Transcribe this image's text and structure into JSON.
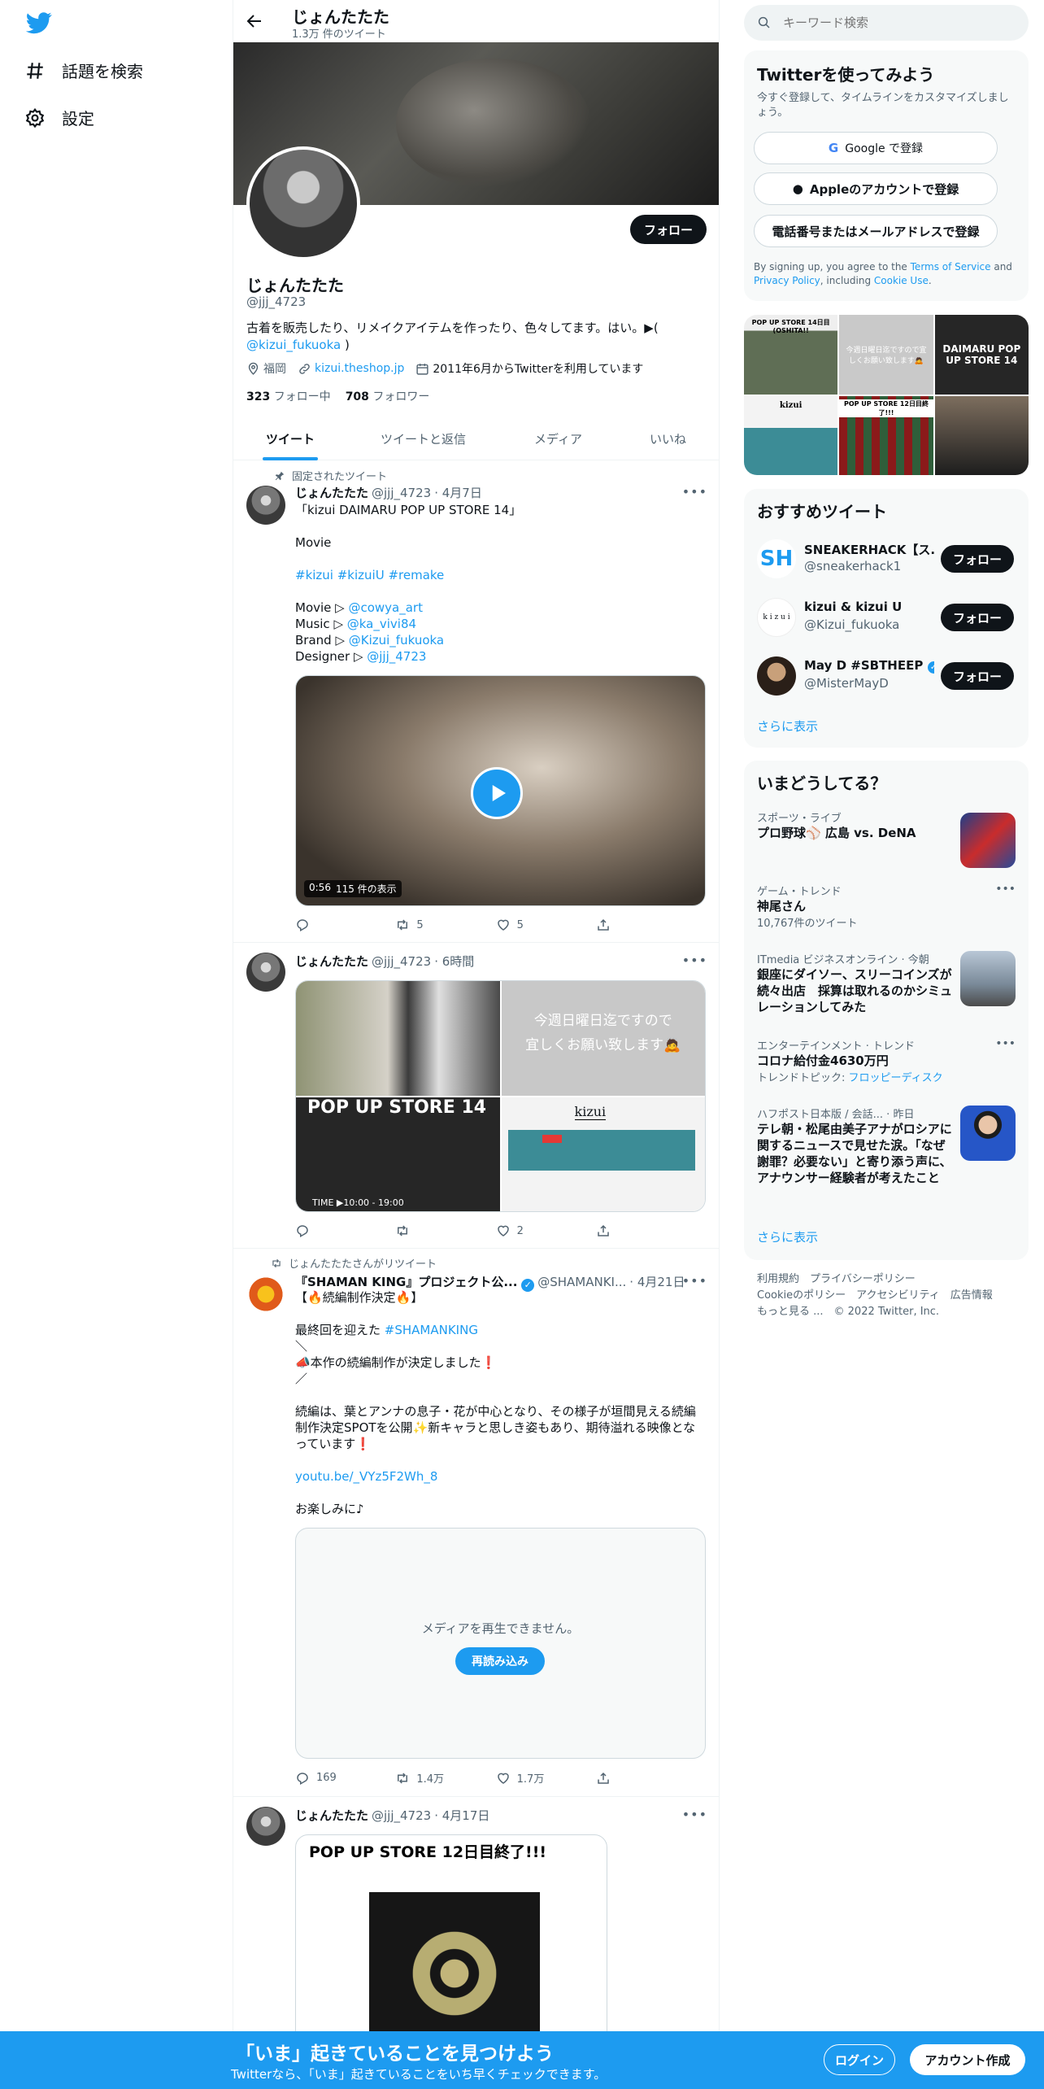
{
  "nav": {
    "explore": "話題を検索",
    "settings": "設定"
  },
  "header": {
    "title": "じょんたたた",
    "tweet_count": "1.3万 件のツイート"
  },
  "profile": {
    "name": "じょんたたた",
    "handle": "@jjj_4723",
    "bio_text": "古着を販売したり、リメイクアイテムを作ったり、色々してます。はい。▶(",
    "bio_link": "@kizui_fukuoka",
    "bio_end": ")",
    "location": "福岡",
    "website": "kizui.theshop.jp",
    "joined": "2011年6月からTwitterを利用しています",
    "following_count": "323",
    "following_label": "フォロー中",
    "followers_count": "708",
    "followers_label": "フォロワー",
    "follow_button": "フォロー"
  },
  "tabs": [
    "ツイート",
    "ツイートと返信",
    "メディア",
    "いいね"
  ],
  "tweets": [
    {
      "context": "固定されたツイート",
      "name": "じょんたたた",
      "handle": "@jjj_4723",
      "time": "· 4月7日",
      "text1": "「kizui DAIMARU POP UP STORE 14」\n\nMovie\n",
      "hashtags": "#kizui #kizuiU #remake",
      "credits": [
        {
          "label": "Movie ▷ ",
          "link": "@cowya_art"
        },
        {
          "label": "Music ▷ ",
          "link": "@ka_vivi84"
        },
        {
          "label": "Brand ▷ ",
          "link": "@Kizui_fukuoka"
        },
        {
          "label": "Designer ▷ ",
          "link": "@jjj_4723"
        }
      ],
      "video_duration": "0:56",
      "video_views": "115 件の表示",
      "replies": "",
      "retweets": "5",
      "likes": "5"
    },
    {
      "name": "じょんたたた",
      "handle": "@jjj_4723",
      "time": "· 6時間",
      "img2_text": "今週日曜日迄ですので\n宜しくお願い致します🙇",
      "img3_text": "POP UP STORE 14",
      "img3_sub": "TIME ▶10:00 - 19:00",
      "img4_text": "kizui",
      "replies": "",
      "retweets": "",
      "likes": "2"
    },
    {
      "context": "じょんたたたさんがリツイート",
      "name": "『SHAMAN KING』プロジェクト公...",
      "handle": "@SHAMANKI...",
      "time": "· 4月21日",
      "line1": "【🔥続編制作決定🔥】",
      "line2_pre": "最終回を迎えた ",
      "line2_tag": "#SHAMANKING",
      "line3": "＼\n📣本作の続編制作が決定しました❗\n／",
      "line4": "続編は、葉とアンナの息子・花が中心となり、その様子が垣間見える続編制作決定SPOTを公開✨新キャラと思しき姿もあり、期待溢れる映像となっています❗",
      "link": "youtu.be/_VYz5F2Wh_8",
      "line5": "お楽しみに♪",
      "media_error": "メディアを再生できません。",
      "reload": "再読み込み",
      "replies": "169",
      "retweets": "1.4万",
      "likes": "1.7万"
    },
    {
      "name": "じょんたたた",
      "handle": "@jjj_4723",
      "time": "· 4月17日",
      "img_text": "POP UP STORE 12日目終了!!!"
    }
  ],
  "right": {
    "search_placeholder": "キーワード検索",
    "signup_title": "Twitterを使ってみよう",
    "signup_sub": "今すぐ登録して、タイムラインをカスタマイズしましょう。",
    "google_btn": "Google で登録",
    "apple_btn": "Appleのアカウントで登録",
    "phone_btn": "電話番号またはメールアドレスで登録",
    "terms_pre": "By signing up, you agree to the ",
    "terms_link": "Terms of Service",
    "terms_and": " and ",
    "privacy_link": "Privacy Policy",
    "terms_mid": ", including ",
    "cookie_link": "Cookie Use",
    "terms_end": ".",
    "grid": [
      "POP UP STORE 14日目(OSHITA!!",
      "今週日曜日迄ですので宜しくお願い致します🙇",
      "DAIMARU POP UP STORE 14",
      "kizui",
      "POP UP STORE 12日目終了!!!",
      ""
    ],
    "rec_title": "おすすめツイート",
    "recs": [
      {
        "name": "SNEAKERHACK【ス...",
        "handle": "@sneakerhack1",
        "button": "フォロー"
      },
      {
        "name": "kizui & kizui U",
        "handle": "@Kizui_fukuoka",
        "button": "フォロー"
      },
      {
        "name": "May D #SBTHEEP",
        "handle": "@MisterMayD",
        "button": "フォロー"
      }
    ],
    "show_more": "さらに表示",
    "trends_title": "いまどうしてる？",
    "trends": [
      {
        "cat": "スポーツ・ライブ",
        "title": "プロ野球⚾ 広島 vs. DeNA"
      },
      {
        "cat": "ゲーム・トレンド",
        "title": "神尾さん",
        "count": "10,767件のツイート"
      },
      {
        "cat": "ITmedia ビジネスオンライン · 今朝",
        "title": "銀座にダイソー、スリーコインズが続々出店　採算は取れるのかシミュレーションしてみた"
      },
      {
        "cat": "エンターテインメント · トレンド",
        "title": "コロナ給付金4630万円",
        "count_pre": "トレンドトピック: ",
        "count_link": "フロッピーディスク"
      },
      {
        "cat": "ハフポスト日本版 / 会話... · 昨日",
        "title": "テレ朝・松尾由美子アナがロシアに関するニュースで見せた涙。「なぜ謝罪？必要ない」と寄り添う声に、アナウンサー経験者が考えたこと"
      }
    ],
    "trends_more": "さらに表示",
    "footer_line1": "利用規約　プライバシーポリシー",
    "footer_line2": "Cookieのポリシー　アクセシビリティ　広告情報",
    "footer_line3": "もっと見る ...　© 2022 Twitter, Inc."
  },
  "bottom": {
    "headline": "「いま」起きていることを見つけよう",
    "sub": "Twitterなら、「いま」起きていることをいち早くチェックできます。",
    "login": "ログイン",
    "signup": "アカウント作成"
  },
  "colors": {
    "accent": "#1d9bf0",
    "text": "#0f1419",
    "muted": "#536471"
  }
}
